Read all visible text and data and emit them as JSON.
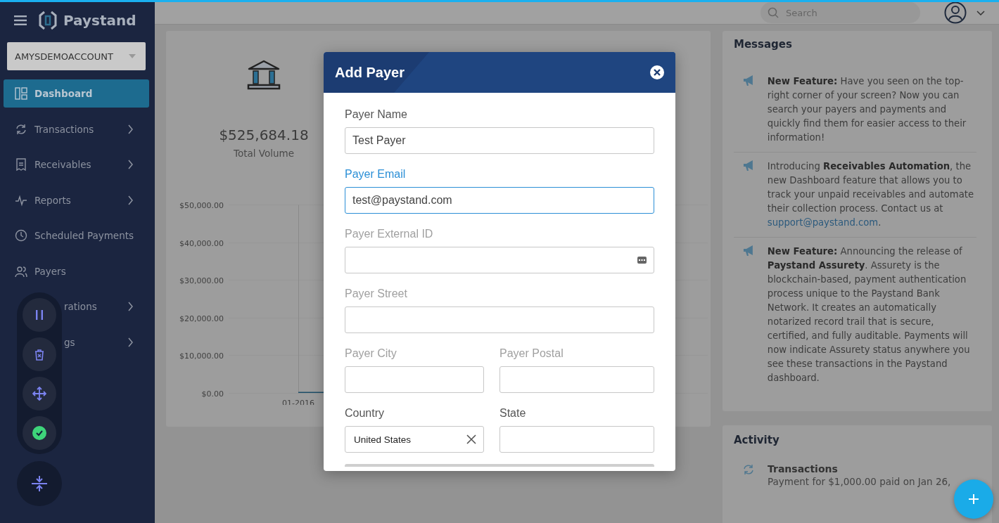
{
  "sidebar": {
    "logo": "Paystand",
    "account": "AMYSDEMOACCOUNT",
    "items": [
      {
        "label": "Dashboard",
        "kind": "dashboard",
        "selected": true,
        "has_submenu": false
      },
      {
        "label": "Transactions",
        "kind": "transactions",
        "selected": false,
        "has_submenu": true
      },
      {
        "label": "Receivables",
        "kind": "receivables",
        "selected": false,
        "has_submenu": true
      },
      {
        "label": "Reports",
        "kind": "reports",
        "selected": false,
        "has_submenu": true
      },
      {
        "label": "Scheduled Payments",
        "kind": "scheduled",
        "selected": false,
        "has_submenu": false
      },
      {
        "label": "Payers",
        "kind": "payers",
        "selected": false,
        "has_submenu": false
      },
      {
        "label": "rations",
        "kind": "covered",
        "selected": false,
        "has_submenu": true
      },
      {
        "label": "gs",
        "kind": "covered",
        "selected": false,
        "has_submenu": true
      }
    ]
  },
  "topbar": {
    "search": {
      "placeholder": "Search"
    }
  },
  "volume_card": {
    "amount": "$525,684.18",
    "label": "Total Volume",
    "chart_data": {
      "type": "bar",
      "categories": [
        "01-2016"
      ],
      "values": [
        0
      ],
      "ylim": [
        0,
        50000
      ],
      "grid": true,
      "ref_lines": [
        {
          "axis": "x",
          "value": "01-2016"
        }
      ],
      "yticks": [
        {
          "value": 0,
          "label": "$0.00"
        },
        {
          "value": 10000,
          "label": "$10,000.00"
        },
        {
          "value": 20000,
          "label": "$20,000.00"
        },
        {
          "value": 30000,
          "label": "$30,000.00"
        },
        {
          "value": 40000,
          "label": "$40,000.00"
        },
        {
          "value": 50000,
          "label": "$50,000.00"
        }
      ]
    }
  },
  "messages": {
    "title": "Messages",
    "items": [
      {
        "text": "**New Feature:** Have you seen on the top-right corner of your screen? Now you can search your payers and payments and quickly find them for easier access to their information!"
      },
      {
        "text": "Introducing **Receivables Automation**, the new Dashboard feature that allows you to track your unpaid receivables and automate their collection process. Contact us at",
        "link": "support@paystand.com",
        "after": "."
      },
      {
        "text": "**New Feature:** Announcing the release of **Paystand Assurety**. Assurety is the blockchain-based, payment authentication process unique to the Paystand Bank Network. It creates an automatically notarized record trail that is secure, certified, and fully auditable. Payments will now indicate Assurety status anywhere you see these transactions in the Paystand dashboard."
      }
    ]
  },
  "activity": {
    "title": "Activity",
    "items": [
      {
        "title": "Transactions",
        "text": "Payment for $1,000.00 paid on Jan 26,"
      }
    ]
  },
  "modal": {
    "title": "Add Payer",
    "fields": [
      {
        "label": "Payer Name",
        "value": "Test Payer",
        "kind": "text",
        "focused": false
      },
      {
        "label": "Payer Email",
        "value": "test@paystand.com",
        "kind": "text",
        "focused": true
      },
      {
        "label": "Payer External ID",
        "kind": "id",
        "focused": false
      },
      {
        "label": "Payer Street",
        "kind": "text",
        "focused": false
      },
      {
        "label": "Payer City",
        "kind": "text",
        "focused": false,
        "half": true
      },
      {
        "label": "Payer Postal",
        "kind": "text",
        "focused": false,
        "half": true
      },
      {
        "label": "Country",
        "value": "United States",
        "kind": "select",
        "focused": false,
        "half": true
      },
      {
        "label": "State",
        "kind": "select",
        "focused": false,
        "half": true
      }
    ]
  },
  "recorder": {
    "buttons": [
      {
        "kind": "pause"
      },
      {
        "kind": "discard"
      },
      {
        "kind": "move"
      },
      {
        "kind": "done"
      }
    ],
    "collapse": true
  }
}
